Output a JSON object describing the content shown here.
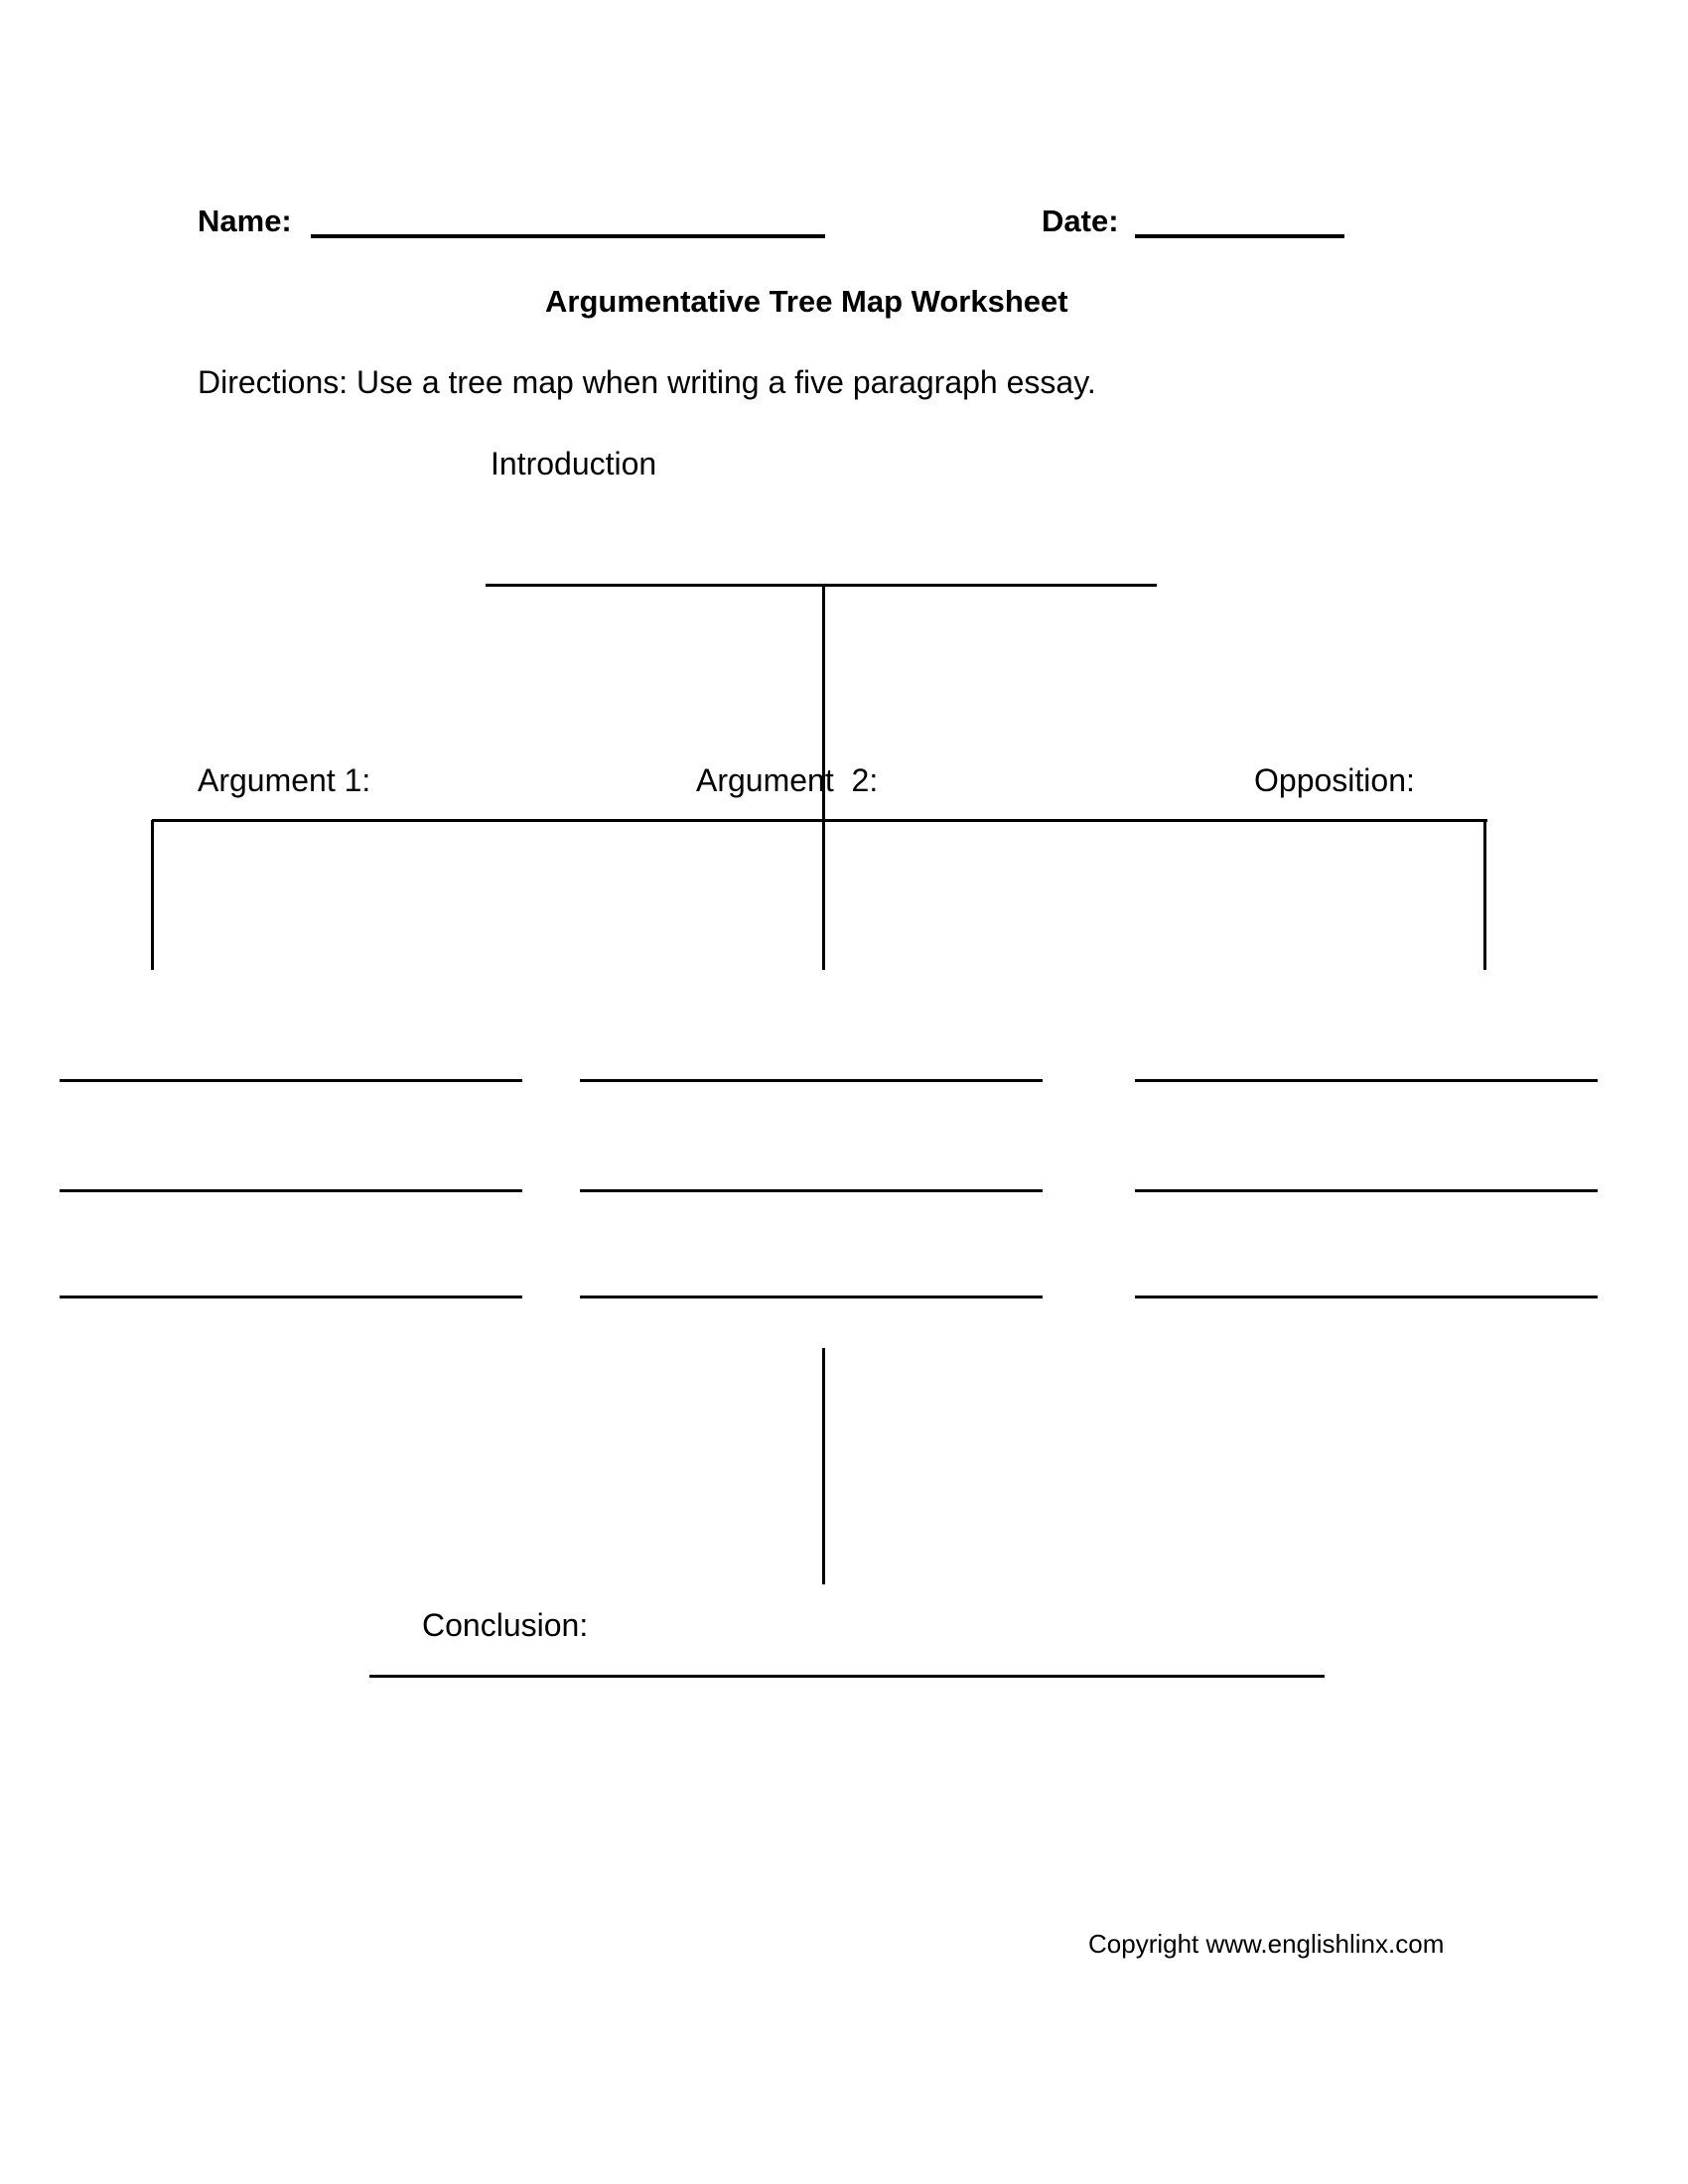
{
  "header": {
    "name_label": "Name:",
    "date_label": "Date:"
  },
  "title": "Argumentative Tree Map Worksheet",
  "directions": "Directions: Use a tree map when writing a five paragraph essay.",
  "tree": {
    "introduction_label": "Introduction",
    "branches": [
      {
        "label": "Argument 1:"
      },
      {
        "label": "Argument  2:"
      },
      {
        "label": "Opposition:"
      }
    ],
    "conclusion_label": "Conclusion:"
  },
  "footer": {
    "copyright": "Copyright www.englishlinx.com"
  }
}
